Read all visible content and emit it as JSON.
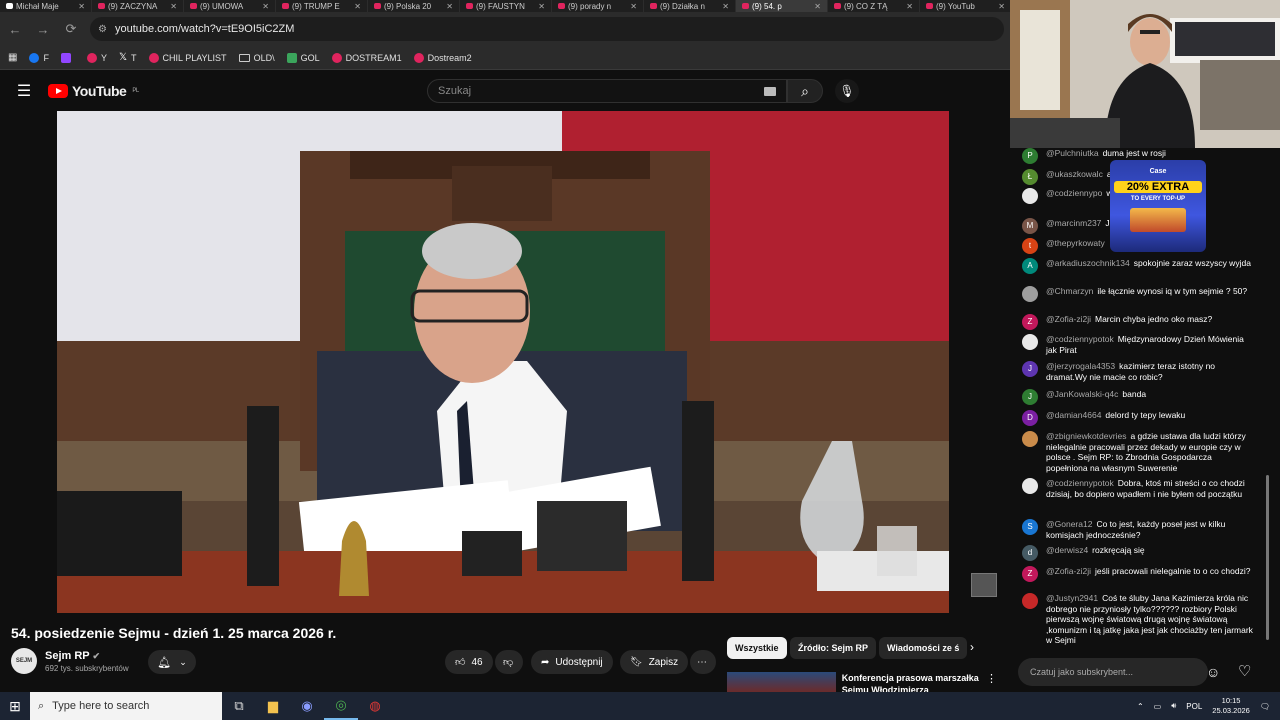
{
  "tabs": [
    {
      "label": "Michał Maje",
      "active": false,
      "x": true
    },
    {
      "label": "(9) ZACZYNA",
      "active": false
    },
    {
      "label": "(9) UMOWA",
      "active": false
    },
    {
      "label": "(9) TRUMP E",
      "active": false
    },
    {
      "label": "(9) Polska 20",
      "active": false
    },
    {
      "label": "(9) FAUSTYN",
      "active": false
    },
    {
      "label": "(9) porady n",
      "active": false
    },
    {
      "label": "(9) Działka n",
      "active": false
    },
    {
      "label": "(9) 54. p",
      "active": true
    },
    {
      "label": "(9) CO Z TĄ",
      "active": false
    },
    {
      "label": "(9) YouTub",
      "active": false
    }
  ],
  "browser": {
    "url": "youtube.com/watch?v=tE9OI5iC2ZM"
  },
  "bookmarks": [
    {
      "label": "F",
      "icon": "fb"
    },
    {
      "label": "",
      "icon": "tw"
    },
    {
      "label": "Y",
      "icon": "yt"
    },
    {
      "label": "T",
      "icon": "x"
    },
    {
      "label": "CHIL PLAYLIST",
      "icon": "yt"
    },
    {
      "label": "OLD\\",
      "icon": "folder"
    },
    {
      "label": "GOL",
      "icon": "gol"
    },
    {
      "label": "DOSTREAM1",
      "icon": "yt"
    },
    {
      "label": "Dostream2",
      "icon": "yt"
    }
  ],
  "youtube": {
    "logo": "YouTube",
    "region": "PL",
    "search_placeholder": "Szukaj"
  },
  "video": {
    "title": "54. posiedzenie Sejmu - dzień 1. 25 marca 2026 r.",
    "channel_name": "Sejm RP",
    "channel_avatar_text": "SEJM",
    "subscribers": "692 tys. subskrybentów",
    "likes": "46",
    "share_label": "Udostępnij",
    "save_label": "Zapisz"
  },
  "chips": [
    {
      "label": "Wszystkie",
      "selected": true
    },
    {
      "label": "Źródło: Sejm RP",
      "selected": false
    },
    {
      "label": "Wiadomości ze ś",
      "selected": false
    }
  ],
  "recommendation": {
    "title": "Konferencja prasowa marszałka Sejmu Włodzimierza"
  },
  "ad": {
    "brand": "Case",
    "headline": "20% EXTRA",
    "sub": "TO EVERY TOP-UP"
  },
  "chat": {
    "input_placeholder": "Czatuj jako subskrybent...",
    "messages": [
      {
        "author": "@Pulchniutka",
        "text": "duma jest w rosji",
        "avatar": "P",
        "color": "#2e7d32"
      },
      {
        "author": "@ukaszkowalc",
        "text": "achujko...",
        "avatar": "Ł",
        "color": "#558b2f"
      },
      {
        "author": "@codziennypo",
        "text": "wencja wysoka o co ch",
        "avatar": "",
        "color": "#e8e8e8"
      },
      {
        "author": "@marcinm237",
        "text": "Jaruzelski",
        "avatar": "M",
        "color": "#795548"
      },
      {
        "author": "@thepyrkowaty",
        "text": "",
        "avatar": "t",
        "color": "#d84315"
      },
      {
        "author": "@arkadiuszochnik134",
        "text": "spokojnie zaraz wszyscy wyjda",
        "avatar": "A",
        "color": "#00897b"
      },
      {
        "author": "@Chmarzyn",
        "text": "ile łącznie wynosi iq w tym sejmie ? 50?",
        "avatar": "",
        "color": "#9e9e9e"
      },
      {
        "author": "@Zofia-zi2ji",
        "text": "Marcin chyba jedno oko masz?",
        "avatar": "Z",
        "color": "#c2185b"
      },
      {
        "author": "@codziennypotok",
        "text": "Międzynarodowy Dzień Mówienia jak Pirat",
        "avatar": "",
        "color": "#e8e8e8"
      },
      {
        "author": "@jerzyrogala4353",
        "text": "kazimierz teraz istotny no dramat.Wy nie macie co robic?",
        "avatar": "J",
        "color": "#5e35b1"
      },
      {
        "author": "@JanKowalski-q4c",
        "text": "banda",
        "avatar": "J",
        "color": "#2e7d32"
      },
      {
        "author": "@damian4664",
        "text": "delord ty tepy lewaku",
        "avatar": "D",
        "color": "#7b1fa2"
      },
      {
        "author": "@zbigniewkotdevries",
        "text": "a gdzie ustawa dla ludzi którzy nielegalnie pracowali przez dekady w europie czy w polsce . Sejm RP: to Zbrodnia Gospodarcza popełniona na własnym Suwerenie",
        "avatar": "",
        "color": "#c98b4a"
      },
      {
        "author": "@codziennypotok",
        "text": "Dobra, ktoś mi streści o co chodzi dzisiaj, bo dopiero wpadłem i nie byłem od początku",
        "avatar": "",
        "color": "#e8e8e8"
      },
      {
        "author": "@Gonera12",
        "text": "Co to jest, każdy poseł jest w kilku komisjach jednocześnie?",
        "avatar": "S",
        "color": "#1976d2"
      },
      {
        "author": "@derwisz4",
        "text": "rozkręcają się",
        "avatar": "d",
        "color": "#455a64"
      },
      {
        "author": "@Zofia-zi2ji",
        "text": "jeśli pracowali nielegalnie to o co chodzi?",
        "avatar": "Z",
        "color": "#c2185b"
      },
      {
        "author": "@Justyn2941",
        "text": "Coś te śluby Jana Kazimierza króla nic dobrego nie przyniosły tylko?????? rozbiory Polski pierwszą wojnę światową drugą wojnę światową ,komunizm i tą jatkę jaka jest jak chociażby ten jarmark w Sejmi",
        "avatar": "",
        "color": "#c62828"
      }
    ]
  },
  "taskbar": {
    "search_placeholder": "Type here to search",
    "language": "POL",
    "time": "10:15",
    "date": "25.03.2026"
  }
}
